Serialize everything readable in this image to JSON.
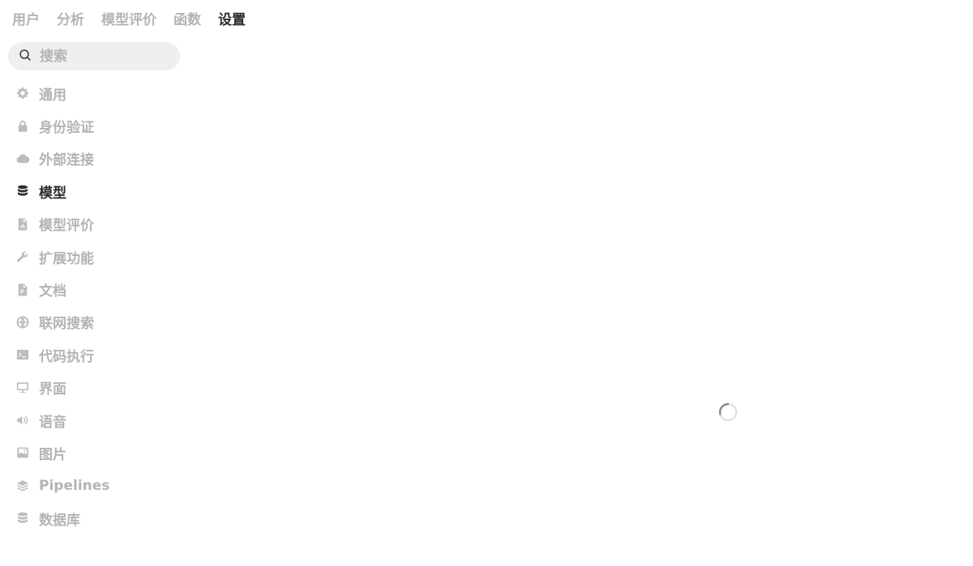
{
  "top_tabs": [
    {
      "label": "用户",
      "active": false
    },
    {
      "label": "分析",
      "active": false
    },
    {
      "label": "模型评价",
      "active": false
    },
    {
      "label": "函数",
      "active": false
    },
    {
      "label": "设置",
      "active": true
    }
  ],
  "search": {
    "placeholder": "搜索",
    "value": "",
    "icon": "search-icon"
  },
  "sidebar": {
    "active_index": 3,
    "items": [
      {
        "label": "通用",
        "icon": "gear-icon"
      },
      {
        "label": "身份验证",
        "icon": "lock-icon"
      },
      {
        "label": "外部连接",
        "icon": "cloud-icon"
      },
      {
        "label": "模型",
        "icon": "database-icon"
      },
      {
        "label": "模型评价",
        "icon": "document-chart-icon"
      },
      {
        "label": "扩展功能",
        "icon": "wrench-icon"
      },
      {
        "label": "文档",
        "icon": "document-search-icon"
      },
      {
        "label": "联网搜索",
        "icon": "globe-icon"
      },
      {
        "label": "代码执行",
        "icon": "terminal-icon"
      },
      {
        "label": "界面",
        "icon": "monitor-icon"
      },
      {
        "label": "语音",
        "icon": "speaker-icon"
      },
      {
        "label": "图片",
        "icon": "image-icon"
      },
      {
        "label": "Pipelines",
        "icon": "layers-icon"
      },
      {
        "label": "数据库",
        "icon": "database-icon"
      }
    ]
  },
  "main": {
    "loading": true,
    "spinner_icon": "loading-spinner-icon"
  },
  "colors": {
    "active_text": "#2d2d2d",
    "inactive_text": "#b4b4b4",
    "search_bg": "#efefef"
  }
}
